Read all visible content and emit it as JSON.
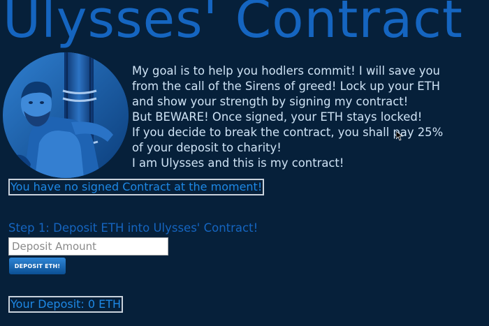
{
  "header": {
    "title": "Ulysses' Contract"
  },
  "portrait": {
    "icon": "ulysses-portrait"
  },
  "intro": {
    "lines": [
      "My goal is to help you hodlers commit! I will save you",
      "from the call of the Sirens of greed! Lock up your ETH",
      "and show your strength by signing my contract!",
      "But BEWARE! Once signed, your ETH stays locked!",
      "If you decide to break the contract, you shall pay 25%",
      "of your deposit to charity!",
      "I am Ulysses and this is my contract!"
    ]
  },
  "status": {
    "text": "You have no signed Contract at the moment!"
  },
  "step1": {
    "label": "Step 1: Deposit ETH into Ulysses' Contract!",
    "placeholder": "Deposit Amount",
    "button_label": "DEPOSIT ETH!"
  },
  "deposit": {
    "text": "Your Deposit: 0 ETH"
  },
  "colors": {
    "background": "#06203a",
    "accent": "#1565c0",
    "text": "#cfe3f5"
  }
}
